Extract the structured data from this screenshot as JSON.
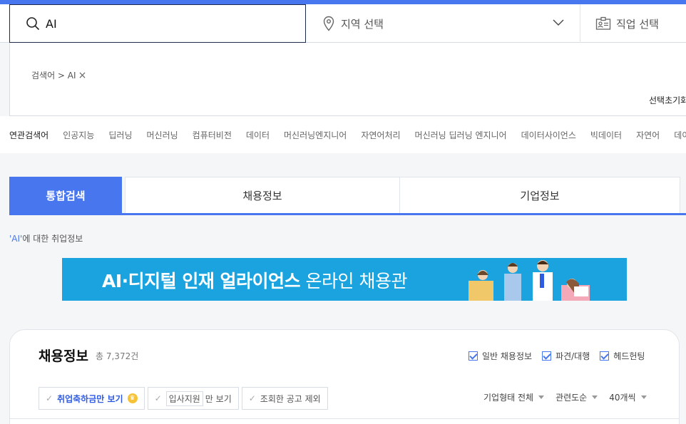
{
  "search": {
    "keyword": "AI",
    "region_placeholder": "지역 선택",
    "job_placeholder": "직업 선택"
  },
  "filter": {
    "tag": "검색어 > AI",
    "reset_label": "선택초기화"
  },
  "related": {
    "title": "연관검색어",
    "keywords": [
      "인공지능",
      "딥러닝",
      "머신러닝",
      "컴퓨터비전",
      "데이터",
      "머신러닝엔지니어",
      "자연어처리",
      "머신러닝 딥러닝 엔지니어",
      "데이터사이언스",
      "빅데이터",
      "자연어",
      "데이터"
    ]
  },
  "tabs": [
    {
      "label": "통합검색",
      "active": true
    },
    {
      "label": "채용정보",
      "active": false
    },
    {
      "label": "기업정보",
      "active": false
    }
  ],
  "result": {
    "query": "'AI'",
    "suffix": "에 대한 취업정보"
  },
  "banner": {
    "bold": "AI·디지털 인재 얼라이언스",
    "normal": " 온라인 채용관"
  },
  "jobs": {
    "title": "채용정보",
    "count": "총 7,372건",
    "checks": [
      "일반 채용정보",
      "파견/대행",
      "헤드헌팅"
    ],
    "pills": {
      "celebrate": "취업축하금만 보기",
      "apply_tag": "입사지원",
      "apply_suffix": "만 보기",
      "exclude": "조회한 공고 제외"
    },
    "sorts": [
      "기업형태 전체",
      "관련도순",
      "40개씩"
    ]
  },
  "colors": {
    "accent": "#4876ef",
    "banner": "#1aa3de",
    "crown": "#f6c338"
  }
}
